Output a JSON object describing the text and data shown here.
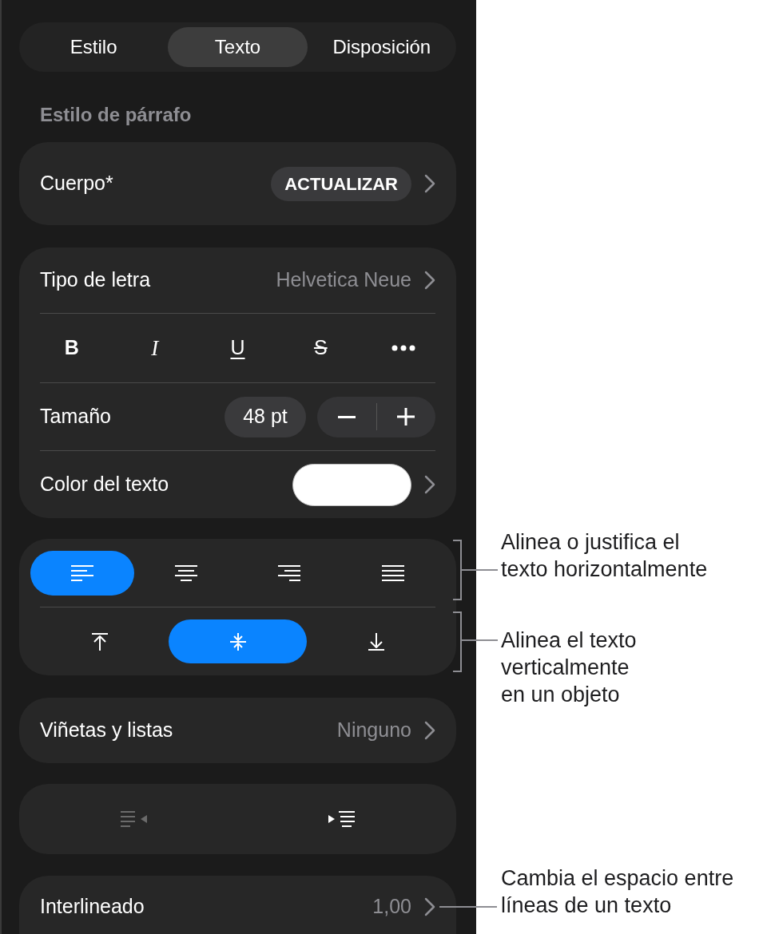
{
  "tabs": [
    {
      "label": "Estilo",
      "selected": false
    },
    {
      "label": "Texto",
      "selected": true
    },
    {
      "label": "Disposición",
      "selected": false
    }
  ],
  "section_title": "Estilo de párrafo",
  "paragraph_style": {
    "label": "Cuerpo*",
    "button": "ACTUALIZAR"
  },
  "font": {
    "label": "Tipo de letra",
    "value": "Helvetica Neue"
  },
  "style_buttons": [
    {
      "kind": "bold",
      "label": "B"
    },
    {
      "kind": "italic",
      "label": "I"
    },
    {
      "kind": "underline",
      "label": "U"
    },
    {
      "kind": "strikethrough",
      "label": "S"
    },
    {
      "kind": "more"
    }
  ],
  "size": {
    "label": "Tamaño",
    "value": "48 pt"
  },
  "text_color": {
    "label": "Color del texto",
    "color": "#ffffff"
  },
  "horizontal_alignment": {
    "options": [
      {
        "kind": "left",
        "selected": true
      },
      {
        "kind": "center",
        "selected": false
      },
      {
        "kind": "right",
        "selected": false
      },
      {
        "kind": "justify",
        "selected": false
      }
    ],
    "callout": {
      "lines": [
        "Alinea o justifica el",
        "texto horizontalmente"
      ]
    }
  },
  "vertical_alignment": {
    "options": [
      {
        "kind": "top",
        "selected": false
      },
      {
        "kind": "middle",
        "selected": true
      },
      {
        "kind": "bottom",
        "selected": false
      }
    ],
    "callout": {
      "lines": [
        "Alinea el texto",
        "verticalmente",
        "en un objeto"
      ]
    }
  },
  "bullets": {
    "label": "Viñetas y listas",
    "value": "Ninguno"
  },
  "indent_buttons": [
    {
      "kind": "outdent",
      "disabled": true
    },
    {
      "kind": "indent",
      "disabled": false
    }
  ],
  "line_spacing": {
    "label": "Interlineado",
    "value": "1,00",
    "callout": {
      "lines": [
        "Cambia el espacio entre",
        "líneas de un texto"
      ]
    }
  }
}
